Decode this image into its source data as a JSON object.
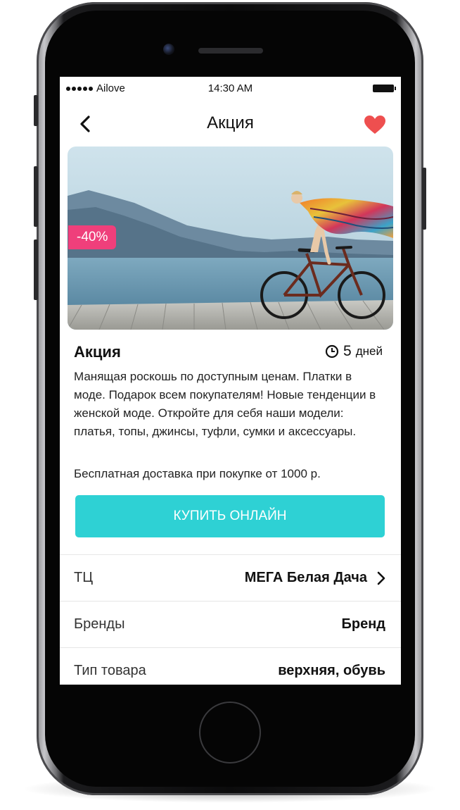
{
  "status_bar": {
    "carrier": "Ailove",
    "time": "14:30 AM"
  },
  "nav": {
    "title": "Акция",
    "back_icon": "chevron-left-icon",
    "favorite_icon": "heart-icon"
  },
  "promo": {
    "discount_badge": "-40%",
    "title": "Акция",
    "days_value": "5",
    "days_unit": "дней",
    "description": "Манящая роскошь по доступным ценам. Платки в моде. Подарок всем покупателям! Новые тенденции в женской моде. Откройте для себя наши модели: платья, топы, джинсы, туфли, сумки и аксессуары.",
    "delivery": "Бесплатная доставка при покупке от 1000 р.",
    "buy_button": "КУПИТЬ ОНЛАЙН"
  },
  "details": [
    {
      "label": "ТЦ",
      "value": "МЕГА Белая Дача",
      "has_chevron": true
    },
    {
      "label": "Бренды",
      "value": "Бренд",
      "has_chevron": false
    },
    {
      "label": "Тип товара",
      "value": "верхняя, обувь",
      "has_chevron": false
    }
  ],
  "colors": {
    "accent": "#2ed1d4",
    "badge": "#ef3f7b",
    "heart": "#ee4f4f"
  }
}
